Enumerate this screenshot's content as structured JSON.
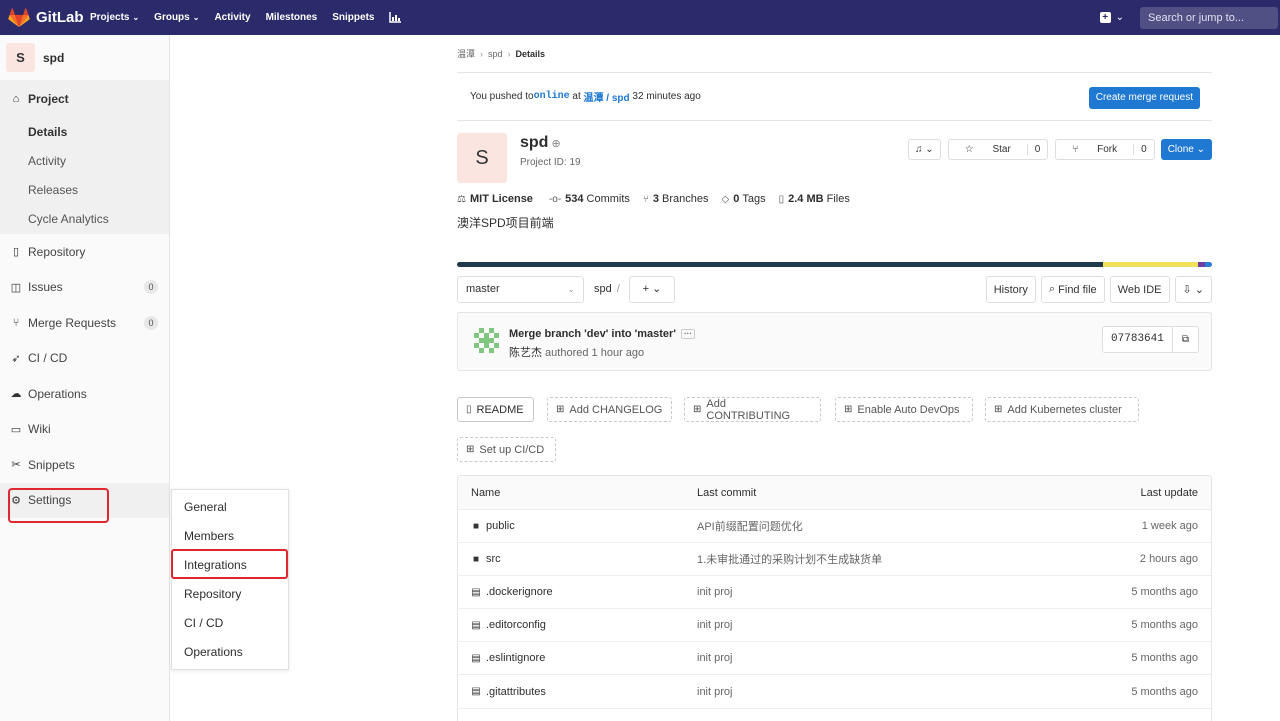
{
  "topnav": {
    "brand": "GitLab",
    "links": [
      {
        "label": "Projects",
        "dropdown": true
      },
      {
        "label": "Groups",
        "dropdown": true
      },
      {
        "label": "Activity",
        "dropdown": false
      },
      {
        "label": "Milestones",
        "dropdown": false
      },
      {
        "label": "Snippets",
        "dropdown": false
      }
    ],
    "search_placeholder": "Search or jump to..."
  },
  "sidebar": {
    "project_initial": "S",
    "project_name": "spd",
    "project_section": "Project",
    "project_sub": [
      "Details",
      "Activity",
      "Releases",
      "Cycle Analytics"
    ],
    "items": [
      {
        "label": "Repository",
        "icon": "repository-icon",
        "count": ""
      },
      {
        "label": "Issues",
        "icon": "issues-icon",
        "count": "0"
      },
      {
        "label": "Merge Requests",
        "icon": "merge-request-icon",
        "count": "0"
      },
      {
        "label": "CI / CD",
        "icon": "rocket-icon",
        "count": ""
      },
      {
        "label": "Operations",
        "icon": "cloud-gear-icon",
        "count": ""
      },
      {
        "label": "Wiki",
        "icon": "book-icon",
        "count": ""
      },
      {
        "label": "Snippets",
        "icon": "scissors-icon",
        "count": ""
      },
      {
        "label": "Settings",
        "icon": "gear-icon",
        "count": ""
      }
    ]
  },
  "settings_flyout": [
    "General",
    "Members",
    "Integrations",
    "Repository",
    "CI / CD",
    "Operations"
  ],
  "breadcrumb": [
    "温潭",
    "spd",
    "Details"
  ],
  "push_banner": {
    "prefix": "You pushed to ",
    "branch": "online",
    "mid": " at ",
    "project": "温潭 / spd",
    "suffix": " 32 minutes ago",
    "button": "Create merge request"
  },
  "project": {
    "initial": "S",
    "name": "spd",
    "id_label": "Project ID: 19",
    "star_label": "Star",
    "star_count": "0",
    "fork_label": "Fork",
    "fork_count": "0",
    "clone_label": "Clone",
    "stats": [
      {
        "icon": "license-icon",
        "bold": "MIT License",
        "rest": ""
      },
      {
        "icon": "commit-icon",
        "bold": "534",
        "rest": "Commits"
      },
      {
        "icon": "branch-icon",
        "bold": "3",
        "rest": "Branches"
      },
      {
        "icon": "tag-icon",
        "bold": "0",
        "rest": "Tags"
      },
      {
        "icon": "file-icon",
        "bold": "2.4 MB",
        "rest": "Files"
      }
    ],
    "description": "澳洋SPD项目前端"
  },
  "language_bar": [
    {
      "color": "#1f3a4d",
      "fraction": 0.855
    },
    {
      "color": "#f1e05a",
      "fraction": 0.127
    },
    {
      "color": "#6c3fa0",
      "fraction": 0.009
    },
    {
      "color": "#2e7cd6",
      "fraction": 0.009
    }
  ],
  "toolbar": {
    "branch": "master",
    "path": "spd",
    "plus": "+",
    "history": "History",
    "find_file": "Find file",
    "web_ide": "Web IDE"
  },
  "last_commit": {
    "title": "Merge branch 'dev' into 'master'",
    "more": "···",
    "author": "陈艺杰",
    "authored": " authored 1 hour ago",
    "sha": "07783641"
  },
  "quick_actions": [
    {
      "label": "README",
      "solid": true
    },
    {
      "label": "Add CHANGELOG",
      "solid": false
    },
    {
      "label": "Add CONTRIBUTING",
      "solid": false
    },
    {
      "label": "Enable Auto DevOps",
      "solid": false
    },
    {
      "label": "Add Kubernetes cluster",
      "solid": false
    },
    {
      "label": "Set up CI/CD",
      "solid": false
    }
  ],
  "file_table": {
    "headers": [
      "Name",
      "Last commit",
      "Last update"
    ],
    "rows": [
      {
        "type": "folder",
        "name": "public",
        "commit": "API前缀配置问题优化",
        "updated": "1 week ago"
      },
      {
        "type": "folder",
        "name": "src",
        "commit": "1.未审批通过的采购计划不生成缺货单",
        "updated": "2 hours ago"
      },
      {
        "type": "file",
        "name": ".dockerignore",
        "commit": "init proj",
        "updated": "5 months ago"
      },
      {
        "type": "file",
        "name": ".editorconfig",
        "commit": "init proj",
        "updated": "5 months ago"
      },
      {
        "type": "file",
        "name": ".eslintignore",
        "commit": "init proj",
        "updated": "5 months ago"
      },
      {
        "type": "file",
        "name": ".gitattributes",
        "commit": "init proj",
        "updated": "5 months ago"
      }
    ]
  }
}
